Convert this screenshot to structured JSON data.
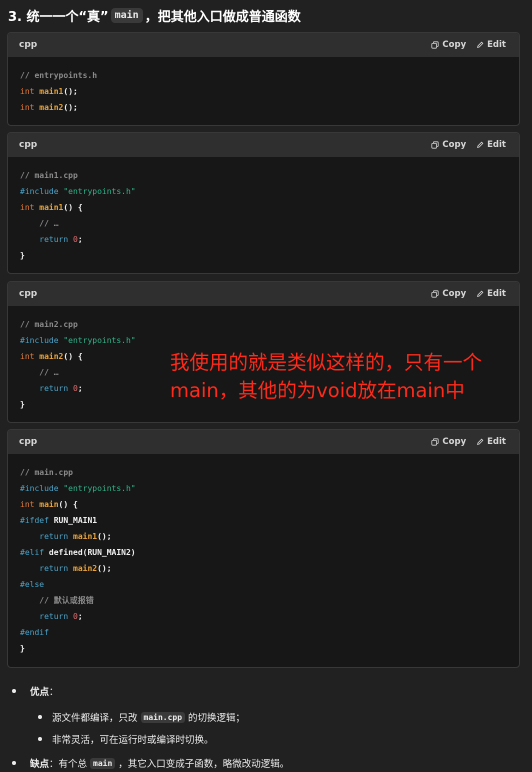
{
  "heading": {
    "prefix": "3. 统一一个“真”",
    "code": "main",
    "suffix": "，把其他入口做成普通函数"
  },
  "actions": {
    "copy": "Copy",
    "edit": "Edit"
  },
  "blocks": [
    {
      "lang": "cpp",
      "lines": [
        [
          {
            "t": "// entrypoints.h",
            "c": "cm"
          }
        ],
        [
          {
            "t": "int",
            "c": "kw"
          },
          {
            "t": " "
          },
          {
            "t": "main1",
            "c": "fn"
          },
          {
            "t": "();",
            "c": "b"
          }
        ],
        [
          {
            "t": "int",
            "c": "kw"
          },
          {
            "t": " "
          },
          {
            "t": "main2",
            "c": "fn"
          },
          {
            "t": "();",
            "c": "b"
          }
        ]
      ]
    },
    {
      "lang": "cpp",
      "lines": [
        [
          {
            "t": "// main1.cpp",
            "c": "cm"
          }
        ],
        [
          {
            "t": "#include",
            "c": "pp"
          },
          {
            "t": " "
          },
          {
            "t": "\"entrypoints.h\"",
            "c": "st"
          }
        ],
        [
          {
            "t": "int",
            "c": "kw"
          },
          {
            "t": " "
          },
          {
            "t": "main1",
            "c": "fn"
          },
          {
            "t": "() {",
            "c": "b"
          }
        ],
        [
          {
            "t": "    "
          },
          {
            "t": "// …",
            "c": "cm"
          }
        ],
        [
          {
            "t": "    "
          },
          {
            "t": "return",
            "c": "pp"
          },
          {
            "t": " "
          },
          {
            "t": "0",
            "c": "num"
          },
          {
            "t": ";",
            "c": "b"
          }
        ],
        [
          {
            "t": "}",
            "c": "b"
          }
        ]
      ]
    },
    {
      "lang": "cpp",
      "lines": [
        [
          {
            "t": "// main2.cpp",
            "c": "cm"
          }
        ],
        [
          {
            "t": "#include",
            "c": "pp"
          },
          {
            "t": " "
          },
          {
            "t": "\"entrypoints.h\"",
            "c": "st"
          }
        ],
        [
          {
            "t": "int",
            "c": "kw"
          },
          {
            "t": " "
          },
          {
            "t": "main2",
            "c": "fn"
          },
          {
            "t": "() {",
            "c": "b"
          }
        ],
        [
          {
            "t": "    "
          },
          {
            "t": "// …",
            "c": "cm"
          }
        ],
        [
          {
            "t": "    "
          },
          {
            "t": "return",
            "c": "pp"
          },
          {
            "t": " "
          },
          {
            "t": "0",
            "c": "num"
          },
          {
            "t": ";",
            "c": "b"
          }
        ],
        [
          {
            "t": "}",
            "c": "b"
          }
        ]
      ]
    },
    {
      "lang": "cpp",
      "lines": [
        [
          {
            "t": "// main.cpp",
            "c": "cm"
          }
        ],
        [
          {
            "t": "#include",
            "c": "pp"
          },
          {
            "t": " "
          },
          {
            "t": "\"entrypoints.h\"",
            "c": "st"
          }
        ],
        [
          {
            "t": "int",
            "c": "kw"
          },
          {
            "t": " "
          },
          {
            "t": "main",
            "c": "fn"
          },
          {
            "t": "() {",
            "c": "b"
          }
        ],
        [
          {
            "t": "#ifdef",
            "c": "pp"
          },
          {
            "t": " "
          },
          {
            "t": "RUN_MAIN1",
            "c": "b"
          }
        ],
        [
          {
            "t": "    "
          },
          {
            "t": "return",
            "c": "pp"
          },
          {
            "t": " "
          },
          {
            "t": "main1",
            "c": "fn"
          },
          {
            "t": "();",
            "c": "b"
          }
        ],
        [
          {
            "t": "#elif",
            "c": "pp"
          },
          {
            "t": " "
          },
          {
            "t": "defined(RUN_MAIN2)",
            "c": "b"
          }
        ],
        [
          {
            "t": "    "
          },
          {
            "t": "return",
            "c": "pp"
          },
          {
            "t": " "
          },
          {
            "t": "main2",
            "c": "fn"
          },
          {
            "t": "();",
            "c": "b"
          }
        ],
        [
          {
            "t": "#else",
            "c": "pp"
          }
        ],
        [
          {
            "t": "    "
          },
          {
            "t": "// 默认或报错",
            "c": "cm"
          }
        ],
        [
          {
            "t": "    "
          },
          {
            "t": "return",
            "c": "pp"
          },
          {
            "t": " "
          },
          {
            "t": "0",
            "c": "num"
          },
          {
            "t": ";",
            "c": "b"
          }
        ],
        [
          {
            "t": "#endif",
            "c": "pp"
          }
        ],
        [
          {
            "t": "}",
            "c": "b"
          }
        ]
      ]
    }
  ],
  "overlay_note": "我使用的就是类似这样的，只有一个main，其他的为void放在main中",
  "bullets": {
    "pros_label": "优点",
    "pros_sep": "：",
    "pro1_a": "源文件都编译，只改",
    "pro1_code": "main.cpp",
    "pro1_b": "的切换逻辑；",
    "pro2": "非常灵活，可在运行时或编译时切换。",
    "cons_label": "缺点",
    "cons_a": "：有个总",
    "cons_code": "main",
    "cons_b": "，其它入口变成子函数，略微改动逻辑。"
  }
}
